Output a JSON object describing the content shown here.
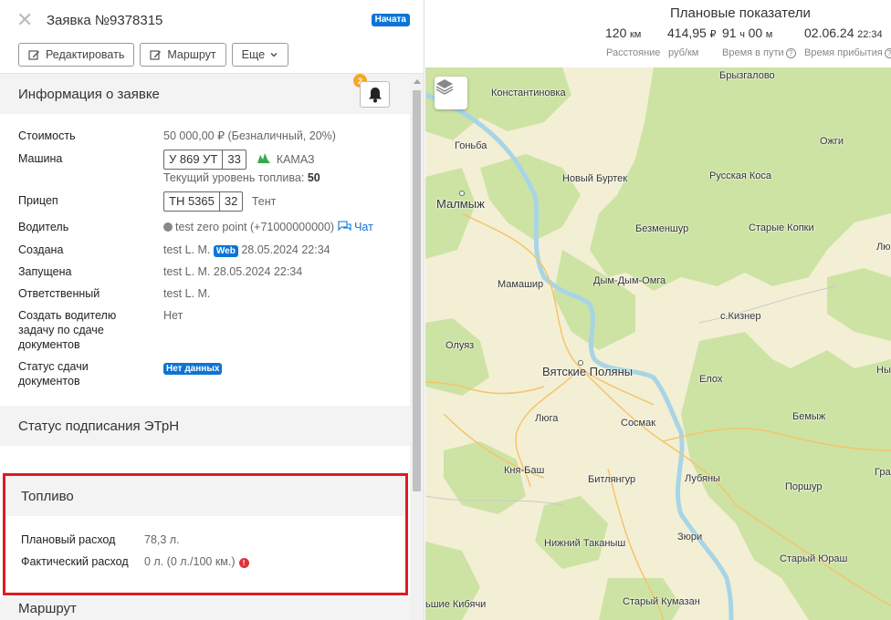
{
  "order": {
    "title": "Заявка №9378315",
    "status": "Начата",
    "buttons": {
      "edit": "Редактировать",
      "route": "Маршрут",
      "more": "Еще"
    }
  },
  "info": {
    "section_title": "Информация о заявке",
    "notification_count": "2",
    "rows": {
      "cost": {
        "label": "Стоимость",
        "value": "50 000,00 ₽ (Безналичный, 20%)"
      },
      "vehicle": {
        "label": "Машина",
        "plate": "У 869 УТ",
        "region": "33",
        "brand": "КАМАЗ",
        "fuel_label": "Текущий уровень топлива:",
        "fuel_value": "50"
      },
      "trailer": {
        "label": "Прицеп",
        "plate": "ТН 5365",
        "region": "32",
        "type": "Тент"
      },
      "driver": {
        "label": "Водитель",
        "value": "test zero point (+71000000000)",
        "chat": "Чат"
      },
      "created": {
        "label": "Создана",
        "user": "test L. M.",
        "source": "Web",
        "date": "28.05.2024 22:34"
      },
      "started": {
        "label": "Запущена",
        "value": "test L. M. 28.05.2024 22:34"
      },
      "responsible": {
        "label": "Ответственный",
        "value": "test L. M."
      },
      "docs_task": {
        "label": "Создать водителю задачу по сдаче документов",
        "value": "Нет"
      },
      "docs_status": {
        "label": "Статус сдачи документов",
        "value": "Нет данных"
      }
    }
  },
  "etrn": {
    "section_title": "Статус подписания ЭТрН"
  },
  "fuel": {
    "section_title": "Топливо",
    "planned": {
      "label": "Плановый расход",
      "value": "78,3 л."
    },
    "actual": {
      "label": "Фактический расход",
      "value": "0 л. (0 л./100 км.)"
    }
  },
  "route": {
    "section_title": "Маршрут"
  },
  "plan": {
    "title": "Плановые показатели",
    "distance": {
      "num": "120",
      "unit": "км",
      "caption": "Расстояние"
    },
    "rate": {
      "num": "414,95",
      "unit": "₽",
      "caption": "руб/км"
    },
    "travel": {
      "num1": "91",
      "unit1": "ч",
      "num2": "00",
      "unit2": "м",
      "caption": "Время в пути"
    },
    "arrival": {
      "date": "02.06.24",
      "time": "22:34",
      "caption": "Время прибытия"
    }
  },
  "map": {
    "towns": [
      "Брызгалово",
      "Константиновка",
      "Гоньба",
      "Ожги",
      "Новый Буртек",
      "Русская Коса",
      "Малмыж",
      "Безменшур",
      "Старые Копки",
      "Лю",
      "Мамашир",
      "Дым-Дым-Омга",
      "с.Кизнер",
      "Олуяз",
      "Вятские Поляны",
      "Елох",
      "Ны",
      "Люга",
      "Сосмак",
      "Бемыж",
      "Кня-Баш",
      "Битлянгур",
      "Лубяны",
      "Грах",
      "Поршур",
      "Нижний Таканыш",
      "Зюри",
      "Старый Юраш",
      "ьшие Кибячи",
      "Старый Кумазан"
    ]
  }
}
